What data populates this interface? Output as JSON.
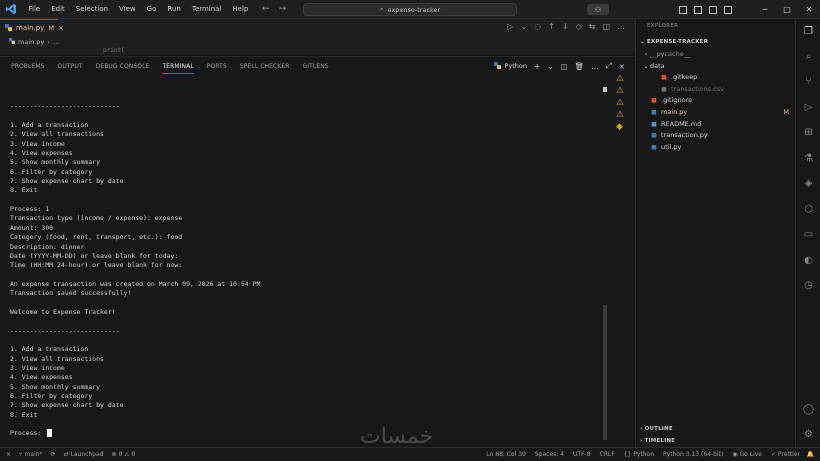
{
  "titlebar": {
    "menu": [
      "File",
      "Edit",
      "Selection",
      "View",
      "Go",
      "Run",
      "Terminal",
      "Help"
    ],
    "search_text": "expense-tracker",
    "window_controls": [
      "─",
      "□",
      "✕"
    ]
  },
  "editor": {
    "tab": {
      "label": "main.py",
      "modified": "M"
    },
    "breadcrumb": [
      "main.py",
      "..."
    ],
    "peek_text": "print("
  },
  "panel": {
    "tabs": [
      "PROBLEMS",
      "OUTPUT",
      "DEBUG CONSOLE",
      "TERMINAL",
      "PORTS",
      "SPELL CHECKER",
      "GITLENS"
    ],
    "active_tab": "TERMINAL",
    "terminal_profile": "Python"
  },
  "terminal": {
    "lines": [
      "",
      "----------------------------",
      "",
      "1. Add a transaction",
      "2. View all transactions",
      "3. View income",
      "4. View expenses",
      "5. Show monthly summary",
      "6. Filter by category",
      "7. Show expense chart by date",
      "8. Exit",
      "",
      "Process: 1",
      "Transaction type (income / expense): expense",
      "Amount: 300",
      "Category (food, rent, transport, etc.): food",
      "Description: dinner",
      "Date (YYYY-MM-DD) or leave blank for today:",
      "Time (HH:MM 24-hour) or leave blank for now:",
      "",
      "An expense transaction was created on March 09, 2026 at 10:54 PM",
      "Transaction saved successfully!",
      "",
      "Welcome to Expense Tracker!",
      "",
      "----------------------------",
      "",
      "1. Add a transaction",
      "2. View all transactions",
      "3. View income",
      "4. View expenses",
      "5. Show monthly summary",
      "6. Filter by category",
      "7. Show expense chart by date",
      "8. Exit",
      ""
    ],
    "prompt": "Process: "
  },
  "explorer": {
    "title": "EXPLORER",
    "section": "EXPENSE-TRACKER",
    "items": [
      {
        "label": "__pycache__",
        "type": "folder",
        "color": "#8a8a8a",
        "depth": 0,
        "chev": "›"
      },
      {
        "label": "data",
        "type": "folder",
        "color": "#cccccc",
        "depth": 0,
        "chev": "⌄"
      },
      {
        "label": ".gitkeep",
        "type": "file",
        "color": "#cccccc",
        "depth": 1,
        "icon_color": "#e44d26"
      },
      {
        "label": "transactions.csv",
        "type": "file",
        "color": "#6f6f6f",
        "depth": 1,
        "icon_color": "#6f6f6f"
      },
      {
        "label": ".gitignore",
        "type": "file",
        "color": "#cccccc",
        "depth": 0,
        "icon_color": "#e44d26"
      },
      {
        "label": "main.py",
        "type": "file",
        "color": "#e2c08d",
        "depth": 0,
        "icon_color": "#3e7ab8",
        "badge": "M"
      },
      {
        "label": "README.md",
        "type": "file",
        "color": "#cccccc",
        "depth": 0,
        "icon_color": "#519aba"
      },
      {
        "label": "transaction.py",
        "type": "file",
        "color": "#cccccc",
        "depth": 0,
        "icon_color": "#3e7ab8"
      },
      {
        "label": "util.py",
        "type": "file",
        "color": "#cccccc",
        "depth": 0,
        "icon_color": "#3e7ab8"
      }
    ],
    "outline": "OUTLINE",
    "timeline": "TIMELINE"
  },
  "statusbar": {
    "branch": "main*",
    "sync": "",
    "launchpad": "Launchpad",
    "errors": "0",
    "warnings": "0",
    "position": "Ln 68, Col 39",
    "spaces": "Spaces: 4",
    "encoding": "UTF-8",
    "eol": "CRLF",
    "language": "Python",
    "interpreter": "3.13 (64-bit)",
    "golive": "Go Live",
    "prettier": "Prettier"
  },
  "colors": {
    "accent": "#0078d4",
    "warning": "#cca700",
    "modified": "#e2c08d"
  },
  "watermark": "خمسات"
}
